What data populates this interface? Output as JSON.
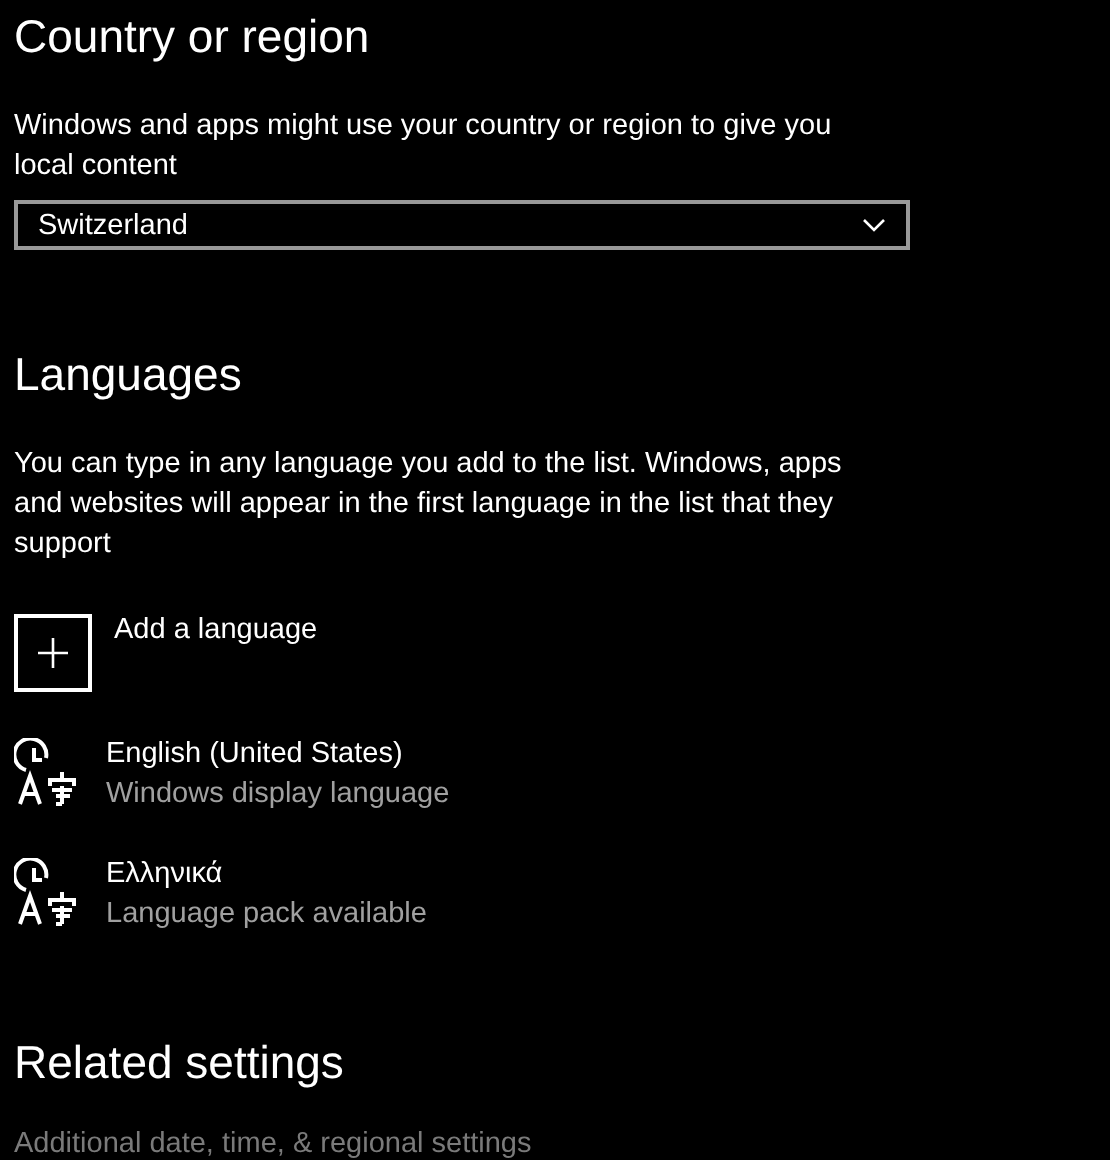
{
  "country_section": {
    "title": "Country or region",
    "description": "Windows and apps might use your country or region to give you local content",
    "dropdown": {
      "value": "Switzerland"
    }
  },
  "languages_section": {
    "title": "Languages",
    "description": "You can type in any language you add to the list. Windows, apps and websites will appear in the first language in the list that they support",
    "add_button": {
      "label": "Add a language"
    },
    "items": [
      {
        "name": "English (United States)",
        "status": "Windows display language"
      },
      {
        "name": "Ελληνικά",
        "status": "Language pack available"
      }
    ]
  },
  "related_section": {
    "title": "Related settings",
    "links": [
      {
        "label": "Additional date, time, & regional settings",
        "disabled": true
      }
    ]
  }
}
